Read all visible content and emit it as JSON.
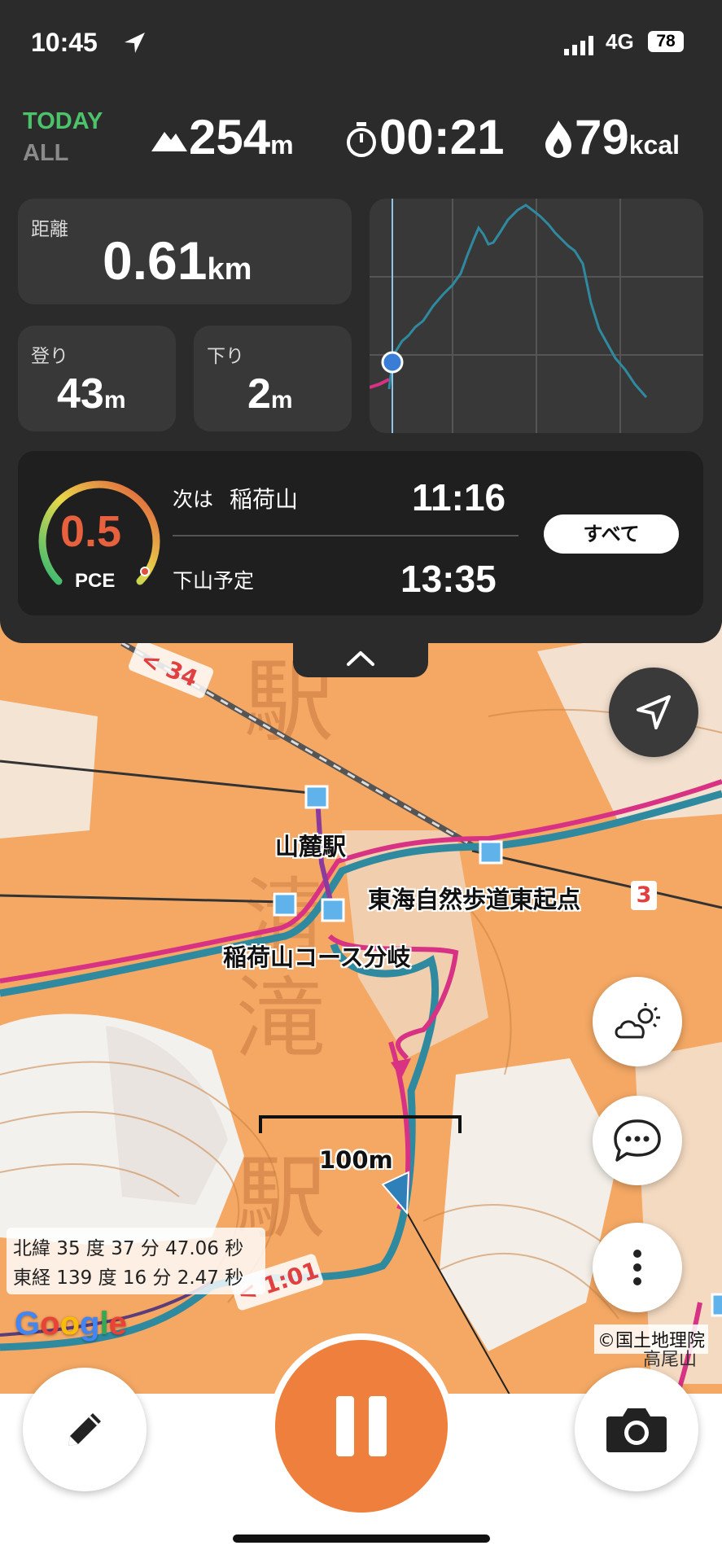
{
  "status": {
    "time": "10:45",
    "network": "4G",
    "battery": "78"
  },
  "summary": {
    "today_label": "TODAY",
    "all_label": "ALL",
    "elevation": "254",
    "elevation_unit": "m",
    "timer": "00:21",
    "calories": "79",
    "calories_unit": "kcal"
  },
  "stats": {
    "distance_label": "距離",
    "distance_value": "0.61",
    "distance_unit": "km",
    "ascent_label": "登り",
    "ascent_value": "43",
    "ascent_unit": "m",
    "descent_label": "下り",
    "descent_value": "2",
    "descent_unit": "m"
  },
  "pace": {
    "value": "0.5",
    "label": "PCE",
    "next_label": "次は",
    "next_place": "稲荷山",
    "next_time": "11:16",
    "descent_plan_label": "下山予定",
    "descent_plan_time": "13:35",
    "all_button": "すべて"
  },
  "map": {
    "labels": {
      "station_foot": "山麓駅",
      "tokai_start": "東海自然歩道東起点",
      "tokai_badge": "3",
      "inari_branch": "稲荷山コース分岐",
      "route_time_top": "< 34",
      "route_time_bottom": "< 1:01",
      "kanji_big_1": "駅",
      "kanji_big_2": "滝",
      "kanji_big_3": "駅",
      "kanji_big_4": "清",
      "takao": "高尾山"
    },
    "scale": "100m",
    "coords_lat": "北緯 35 度 37 分 47.06 秒",
    "coords_lon": "東経 139 度 16 分 2.47 秒",
    "google": "Google",
    "credit": "©国土地理院"
  },
  "colors": {
    "accent": "#ef7f3c",
    "route_pink": "#d83284",
    "route_teal": "#2f8aa0",
    "today_green": "#4cc36a",
    "profile_line": "#2f8aa0"
  },
  "icons": {
    "location": "location-arrow-icon",
    "weather": "cloud-sun-icon",
    "chat": "chat-bubble-icon",
    "more": "more-vertical-icon",
    "edit": "pencil-icon",
    "pause": "pause-icon",
    "camera": "camera-icon"
  }
}
